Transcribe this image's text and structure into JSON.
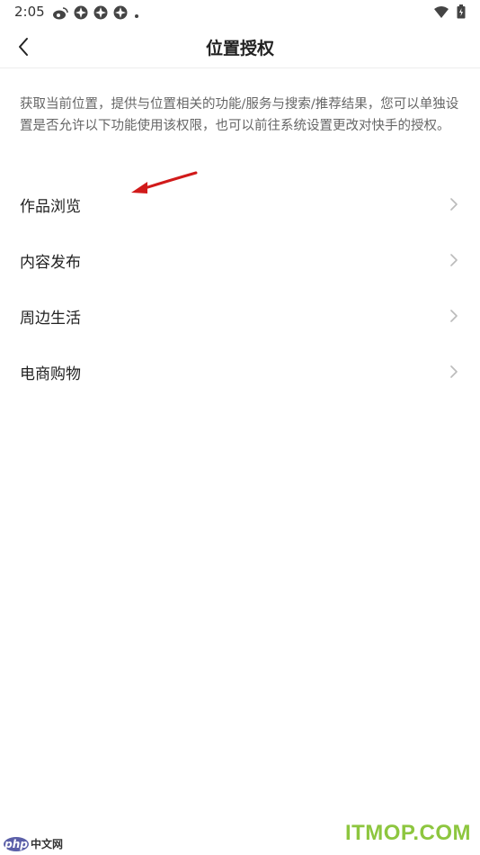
{
  "status_bar": {
    "time": "2:05",
    "left_icons": [
      "weibo-icon",
      "app-icon",
      "app-icon",
      "app-icon",
      "dot-icon"
    ],
    "right_icons": [
      "wifi-icon",
      "battery-icon"
    ]
  },
  "nav": {
    "title": "位置授权",
    "back_icon": "chevron-left-icon"
  },
  "description": "获取当前位置，提供与位置相关的功能/服务与搜索/推荐结果，您可以单独设置是否允许以下功能使用该权限，也可以前往系统设置更改对快手的授权。",
  "items": [
    {
      "label": "作品浏览"
    },
    {
      "label": "内容发布"
    },
    {
      "label": "周边生活"
    },
    {
      "label": "电商购物"
    }
  ],
  "colors": {
    "annotation_arrow": "#d11a1a",
    "watermark_itmop": "#8dc63f",
    "php_logo": "#5b5fa8"
  },
  "watermarks": {
    "php_logo": "php",
    "php_text": "中文网",
    "itmop": "ITMOP.COM"
  }
}
